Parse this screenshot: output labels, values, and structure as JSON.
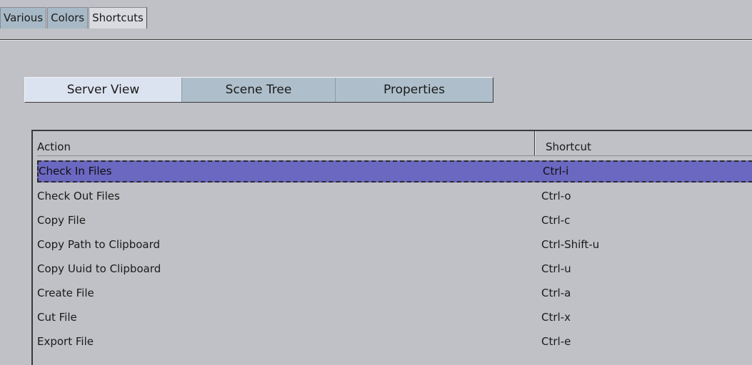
{
  "top_tabs": [
    {
      "label": "Various"
    },
    {
      "label": "Colors"
    },
    {
      "label": "Shortcuts",
      "active": true
    }
  ],
  "sub_tabs": [
    {
      "label": "Server View",
      "active": true
    },
    {
      "label": "Scene Tree"
    },
    {
      "label": "Properties"
    }
  ],
  "table": {
    "headers": {
      "action": "Action",
      "shortcut": "Shortcut"
    },
    "rows": [
      {
        "action": "Check In Files",
        "shortcut": "Ctrl-i"
      },
      {
        "action": "Check Out Files",
        "shortcut": "Ctrl-o"
      },
      {
        "action": "Copy File",
        "shortcut": "Ctrl-c"
      },
      {
        "action": "Copy Path to Clipboard",
        "shortcut": "Ctrl-Shift-u"
      },
      {
        "action": "Copy Uuid to Clipboard",
        "shortcut": "Ctrl-u"
      },
      {
        "action": "Create File",
        "shortcut": "Ctrl-a"
      },
      {
        "action": "Cut File",
        "shortcut": "Ctrl-x"
      },
      {
        "action": "Export File",
        "shortcut": "Ctrl-e"
      }
    ]
  },
  "colors": {
    "selection": "#6b68c2",
    "tab_inactive": "#aebfcb",
    "tab_active": "#dce3f0",
    "background": "#c0c1c6"
  }
}
